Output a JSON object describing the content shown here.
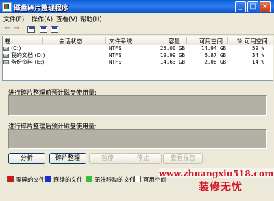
{
  "window": {
    "title": "磁盘碎片整理程序",
    "controls": [
      "_",
      "□",
      "×"
    ]
  },
  "menu": [
    "文件(F)",
    "操作(A)",
    "查看(V)",
    "帮助(H)"
  ],
  "toolbar": [
    "back-icon",
    "forward-icon",
    "volume-view-icon",
    "properties-icon",
    "help-icon"
  ],
  "volumes": {
    "columns": [
      "卷",
      "会话状态",
      "文件系统",
      "容量",
      "可用空间",
      "% 可用空间"
    ],
    "rows": [
      {
        "name": "(C:)",
        "status": "",
        "fs": "NTFS",
        "capacity": "25.00 GB",
        "free": "14.94 GB",
        "pct": "59 %"
      },
      {
        "name": "我的文档 (D:)",
        "status": "",
        "fs": "NTFS",
        "capacity": "19.99 GB",
        "free": "6.87 GB",
        "pct": "34 %"
      },
      {
        "name": "备份资料 (E:)",
        "status": "",
        "fs": "NTFS",
        "capacity": "14.63 GB",
        "free": "2.08 GB",
        "pct": "14 %"
      }
    ]
  },
  "panels": {
    "before_label": "进行碎片整理前预计磁盘使用量:",
    "after_label": "进行碎片整理后预计磁盘使用量:"
  },
  "buttons": {
    "analyze": "分析",
    "defrag": "碎片整理",
    "pause": "暂停",
    "stop": "停止",
    "report": "查看报告"
  },
  "legend": [
    {
      "label": "零碎的文件",
      "color": "#e01010"
    },
    {
      "label": "连续的文件",
      "color": "#1a2fd0"
    },
    {
      "label": "无法移动的文件",
      "color": "#35c035"
    },
    {
      "label": "可用空间",
      "color": "#ffffff"
    }
  ],
  "watermark": {
    "url": "www.zhuangxiu518.com",
    "text": "装修无忧"
  }
}
